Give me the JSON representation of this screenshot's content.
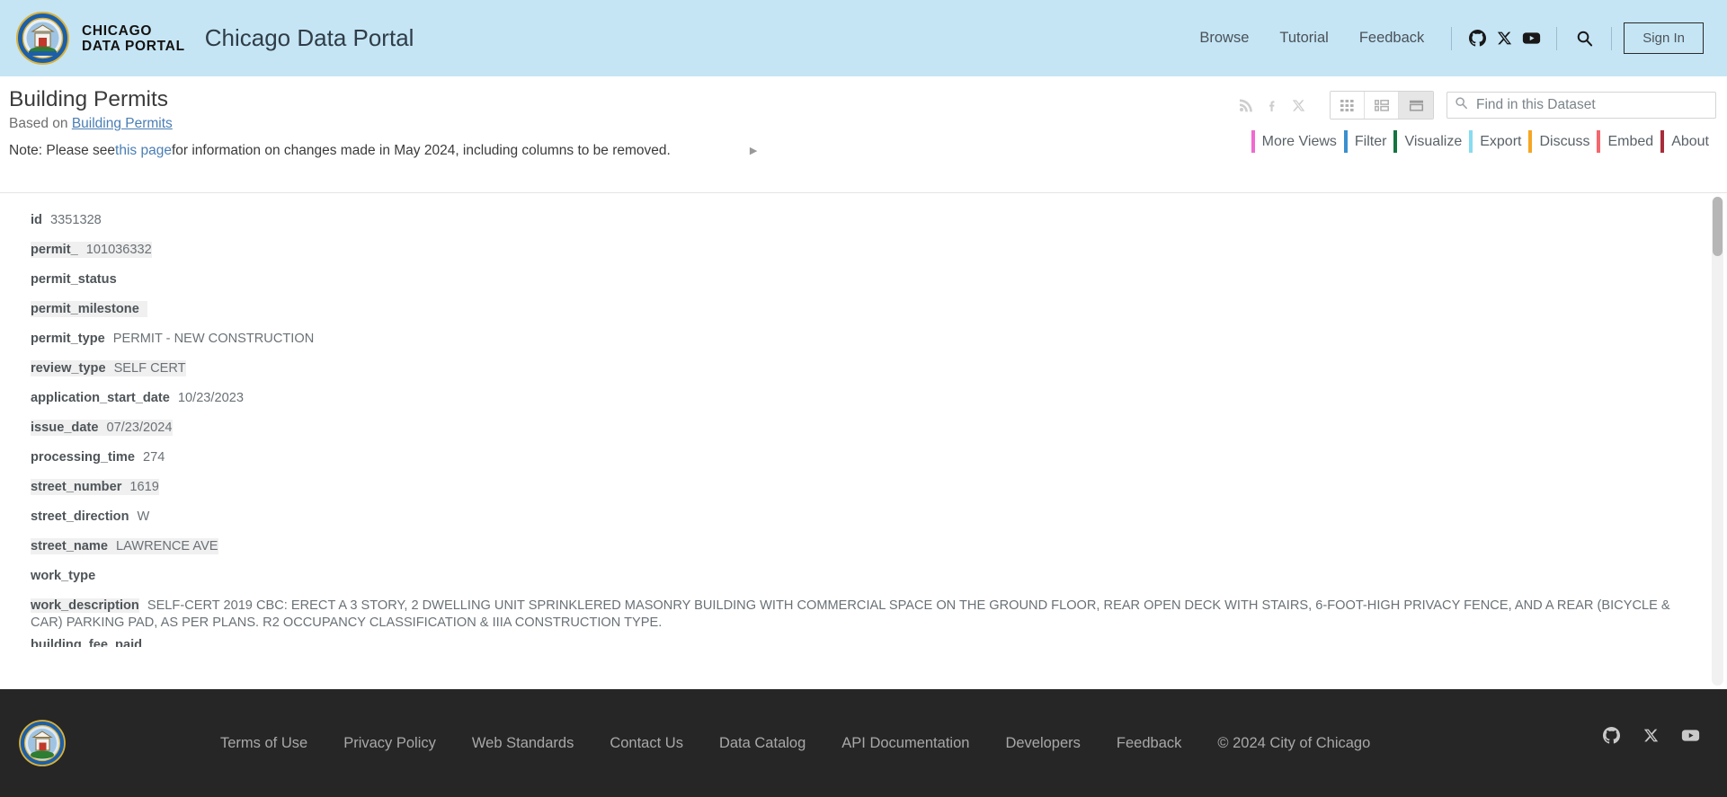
{
  "header": {
    "wordmark_line1": "CHICAGO",
    "wordmark_line2": "DATA PORTAL",
    "portal_title": "Chicago Data Portal",
    "nav": [
      {
        "label": "Browse",
        "name": "nav-browse"
      },
      {
        "label": "Tutorial",
        "name": "nav-tutorial"
      },
      {
        "label": "Feedback",
        "name": "nav-feedback"
      }
    ],
    "social": [
      {
        "icon": "github-icon"
      },
      {
        "icon": "x-twitter-icon"
      },
      {
        "icon": "youtube-icon"
      }
    ],
    "search_icon": "search-icon",
    "sign_in_label": "Sign In"
  },
  "dataset": {
    "title": "Building Permits",
    "based_on_prefix": "Based on ",
    "based_on_link": "Building Permits",
    "note_prefix": "Note: Please see ",
    "note_link": "this page",
    "note_suffix": " for information on changes made in May 2024, including columns to be removed.",
    "note_caret": "▶"
  },
  "toolbar": {
    "share_icons": [
      {
        "icon": "rss-icon"
      },
      {
        "icon": "facebook-icon"
      },
      {
        "icon": "x-twitter-icon"
      }
    ],
    "view_modes": [
      {
        "name": "view-mode-grid",
        "icon": "grid-view-icon",
        "active": false
      },
      {
        "name": "view-mode-card",
        "icon": "card-view-icon",
        "active": false
      },
      {
        "name": "view-mode-single",
        "icon": "single-record-view-icon",
        "active": true
      }
    ],
    "search": {
      "placeholder": "Find in this Dataset",
      "value": "",
      "icon": "search-icon"
    },
    "tabs": [
      {
        "label": "More Views",
        "color": "#f06ad0",
        "name": "tab-more-views"
      },
      {
        "label": "Filter",
        "color": "#3a8fcf",
        "name": "tab-filter"
      },
      {
        "label": "Visualize",
        "color": "#15743f",
        "name": "tab-visualize"
      },
      {
        "label": "Export",
        "color": "#87dcf0",
        "name": "tab-export"
      },
      {
        "label": "Discuss",
        "color": "#f5a623",
        "name": "tab-discuss"
      },
      {
        "label": "Embed",
        "color": "#f4676c",
        "name": "tab-embed"
      },
      {
        "label": "About",
        "color": "#a82d3a",
        "name": "tab-about"
      }
    ]
  },
  "record": {
    "fields": [
      {
        "key": "id",
        "value": "3351328"
      },
      {
        "key": "permit_",
        "value": "101036332"
      },
      {
        "key": "permit_status",
        "value": ""
      },
      {
        "key": "permit_milestone",
        "value": ""
      },
      {
        "key": "permit_type",
        "value": "PERMIT - NEW CONSTRUCTION"
      },
      {
        "key": "review_type",
        "value": "SELF CERT"
      },
      {
        "key": "application_start_date",
        "value": "10/23/2023"
      },
      {
        "key": "issue_date",
        "value": "07/23/2024"
      },
      {
        "key": "processing_time",
        "value": "274"
      },
      {
        "key": "street_number",
        "value": "1619"
      },
      {
        "key": "street_direction",
        "value": "W"
      },
      {
        "key": "street_name",
        "value": "LAWRENCE AVE"
      },
      {
        "key": "work_type",
        "value": ""
      },
      {
        "key": "work_description",
        "value": "SELF-CERT 2019 CBC: ERECT A 3 STORY, 2 DWELLING UNIT SPRINKLERED MASONRY BUILDING WITH COMMERCIAL SPACE ON THE GROUND FLOOR, REAR OPEN DECK WITH STAIRS, 6-FOOT-HIGH PRIVACY FENCE, AND A REAR (BICYCLE & CAR) PARKING PAD, AS PER PLANS. R2 OCCUPANCY CLASSIFICATION & IIIA CONSTRUCTION TYPE."
      }
    ],
    "clipped_key": "building_fee_paid"
  },
  "footer": {
    "links": [
      {
        "label": "Terms of Use",
        "name": "footer-terms-of-use"
      },
      {
        "label": "Privacy Policy",
        "name": "footer-privacy-policy"
      },
      {
        "label": "Web Standards",
        "name": "footer-web-standards"
      },
      {
        "label": "Contact Us",
        "name": "footer-contact-us"
      },
      {
        "label": "Data Catalog",
        "name": "footer-data-catalog"
      },
      {
        "label": "API Documentation",
        "name": "footer-api-documentation"
      },
      {
        "label": "Developers",
        "name": "footer-developers"
      },
      {
        "label": "Feedback",
        "name": "footer-feedback"
      }
    ],
    "copyright": "© 2024 City of Chicago",
    "social": [
      {
        "icon": "github-icon"
      },
      {
        "icon": "x-twitter-icon"
      },
      {
        "icon": "youtube-icon"
      }
    ]
  }
}
